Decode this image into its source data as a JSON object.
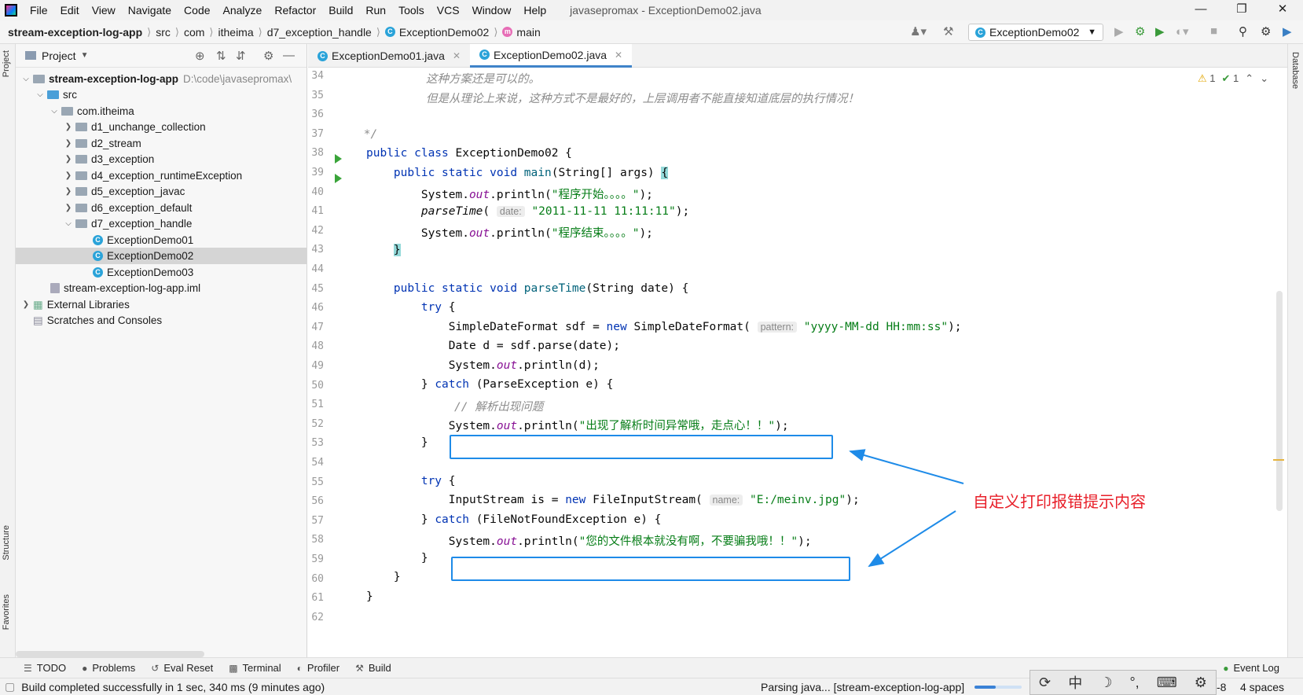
{
  "menubar": {
    "items": [
      "File",
      "Edit",
      "View",
      "Navigate",
      "Code",
      "Analyze",
      "Refactor",
      "Build",
      "Run",
      "Tools",
      "VCS",
      "Window",
      "Help"
    ],
    "title": "javasepromax - ExceptionDemo02.java"
  },
  "breadcrumb": [
    "stream-exception-log-app",
    "src",
    "com",
    "itheima",
    "d7_exception_handle",
    "ExceptionDemo02",
    "main"
  ],
  "run_config": "ExceptionDemo02",
  "project_panel": {
    "title": "Project",
    "tree": [
      {
        "label": "stream-exception-log-app",
        "extra": "D:\\code\\javasepromax\\"
      },
      {
        "label": "src"
      },
      {
        "label": "com.itheima"
      },
      {
        "label": "d1_unchange_collection"
      },
      {
        "label": "d2_stream"
      },
      {
        "label": "d3_exception"
      },
      {
        "label": "d4_exception_runtimeException"
      },
      {
        "label": "d5_exception_javac"
      },
      {
        "label": "d6_exception_default"
      },
      {
        "label": "d7_exception_handle"
      },
      {
        "label": "ExceptionDemo01"
      },
      {
        "label": "ExceptionDemo02"
      },
      {
        "label": "ExceptionDemo03"
      },
      {
        "label": "stream-exception-log-app.iml"
      },
      {
        "label": "External Libraries"
      },
      {
        "label": "Scratches and Consoles"
      }
    ]
  },
  "tabs": [
    "ExceptionDemo01.java",
    "ExceptionDemo02.java"
  ],
  "editor": {
    "line_numbers": [
      "34",
      "35",
      "36",
      "37",
      "38",
      "39",
      "40",
      "41",
      "42",
      "43",
      "44",
      "45",
      "46",
      "47",
      "48",
      "49",
      "50",
      "51",
      "52",
      "53",
      "54",
      "55",
      "56",
      "57",
      "58",
      "59",
      "60",
      "61",
      "62"
    ],
    "inspection": {
      "warnings": "1",
      "checks": "1"
    },
    "comment_34": "这种方案还是可以的。",
    "comment_35": "但是从理论上来说，这种方式不是最好的，上层调用者不能直接知道底层的执行情况！",
    "hint_date": "date:",
    "hint_pattern": "pattern:",
    "hint_name": "name:",
    "str_start": "\"程序开始。。。。\"",
    "str_time": "\"2011-11-11 11:11:11\"",
    "str_end": "\"程序结束。。。。\"",
    "str_pattern": "\"yyyy-MM-dd HH:mm:ss\"",
    "comment_51": "// 解析出现问题",
    "str_parse_err": "\"出现了解析时间异常哦，走点心！！\"",
    "str_file": "\"E:/meinv.jpg\"",
    "str_file_err": "\"您的文件根本就没有啊，不要骗我哦！！\""
  },
  "annotation": "自定义打印报错提示内容",
  "left_stripe": [
    "Project",
    "Structure",
    "Favorites"
  ],
  "right_stripe": [
    "Database"
  ],
  "toolstrip": [
    "TODO",
    "Problems",
    "Eval Reset",
    "Terminal",
    "Profiler",
    "Build",
    "Event Log"
  ],
  "status": {
    "message": "Build completed successfully in 1 sec, 340 ms (9 minutes ago)",
    "progress": "Parsing java... [stream-exception-log-app]",
    "encoding": "-8",
    "indent": "4 spaces"
  },
  "ime": [
    "中"
  ]
}
